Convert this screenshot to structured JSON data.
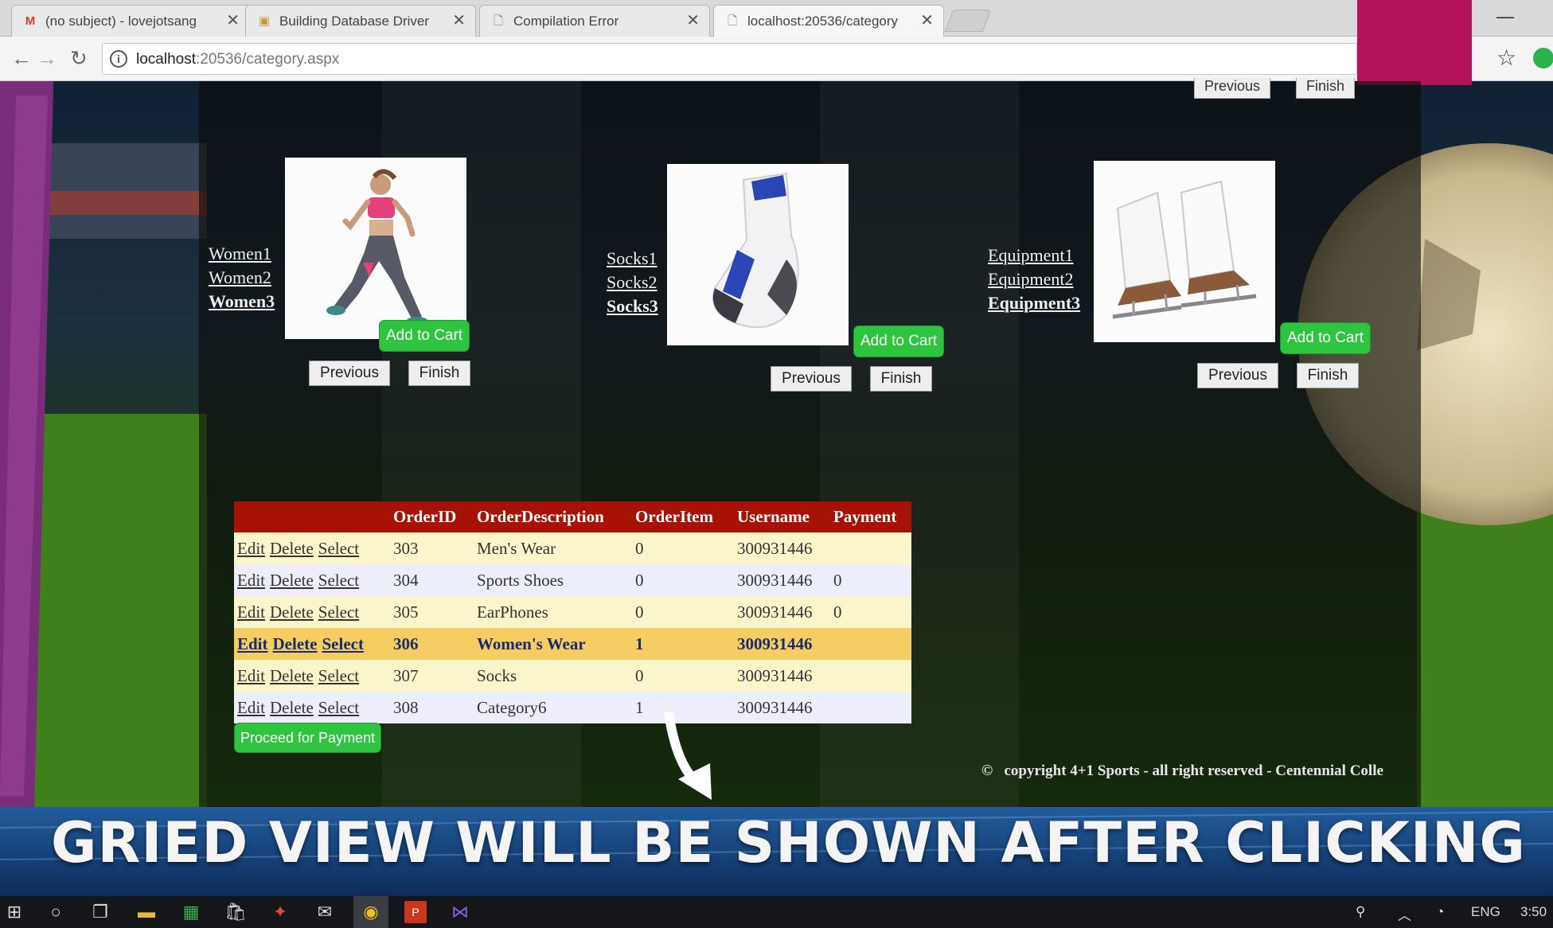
{
  "browser": {
    "tabs": [
      {
        "title": "(no subject) - lovejotsang",
        "favicon": "gmail-icon"
      },
      {
        "title": "Building Database Driver",
        "favicon": "page-icon"
      },
      {
        "title": "Compilation Error",
        "favicon": "document-icon"
      },
      {
        "title": "localhost:20536/category",
        "favicon": "document-icon",
        "active": true
      }
    ],
    "url_host": "localhost",
    "url_rest": ":20536/category.aspx"
  },
  "top_buttons": {
    "previous": "Previous",
    "finish": "Finish"
  },
  "products": [
    {
      "links": [
        "Women1",
        "Women2",
        "Women3"
      ],
      "image": "woman-runner-image",
      "add_label": "Add to Cart",
      "prev_label": "Previous",
      "finish_label": "Finish"
    },
    {
      "links": [
        "Socks1",
        "Socks2",
        "Socks3"
      ],
      "image": "sock-image",
      "add_label": "Add to Cart",
      "prev_label": "Previous",
      "finish_label": "Finish"
    },
    {
      "links": [
        "Equipment1",
        "Equipment2",
        "Equipment3"
      ],
      "image": "ice-skates-image",
      "add_label": "Add to Cart",
      "prev_label": "Previous",
      "finish_label": "Finish"
    }
  ],
  "grid": {
    "headers": [
      "OrderID",
      "OrderDescription",
      "OrderItem",
      "Username",
      "Payment"
    ],
    "actions": [
      "Edit",
      "Delete",
      "Select"
    ],
    "rows": [
      {
        "OrderID": "303",
        "OrderDescription": "Men's Wear",
        "OrderItem": "0",
        "Username": "300931446",
        "Payment": ""
      },
      {
        "OrderID": "304",
        "OrderDescription": "Sports Shoes",
        "OrderItem": "0",
        "Username": "300931446",
        "Payment": "0"
      },
      {
        "OrderID": "305",
        "OrderDescription": "EarPhones",
        "OrderItem": "0",
        "Username": "300931446",
        "Payment": "0"
      },
      {
        "OrderID": "306",
        "OrderDescription": "Women's Wear",
        "OrderItem": "1",
        "Username": "300931446",
        "Payment": "",
        "selected": true
      },
      {
        "OrderID": "307",
        "OrderDescription": "Socks",
        "OrderItem": "0",
        "Username": "300931446",
        "Payment": ""
      },
      {
        "OrderID": "308",
        "OrderDescription": "Category6",
        "OrderItem": "1",
        "Username": "300931446",
        "Payment": ""
      }
    ]
  },
  "proceed_label": "Proceed for Payment",
  "copyright_symbol": "©",
  "copyright_text": "copyright 4+1 Sports - all right reserved - Centennial Colle",
  "caption": "GRIED VIEW WILL BE SHOWN AFTER CLICKING",
  "taskbar": {
    "lang": "ENG",
    "time": "3:50"
  },
  "colors": {
    "header_red": "#a61206",
    "accent_green": "#2fc43f",
    "selected_row": "#f5cd62",
    "slide_magenta": "#b3135a"
  }
}
